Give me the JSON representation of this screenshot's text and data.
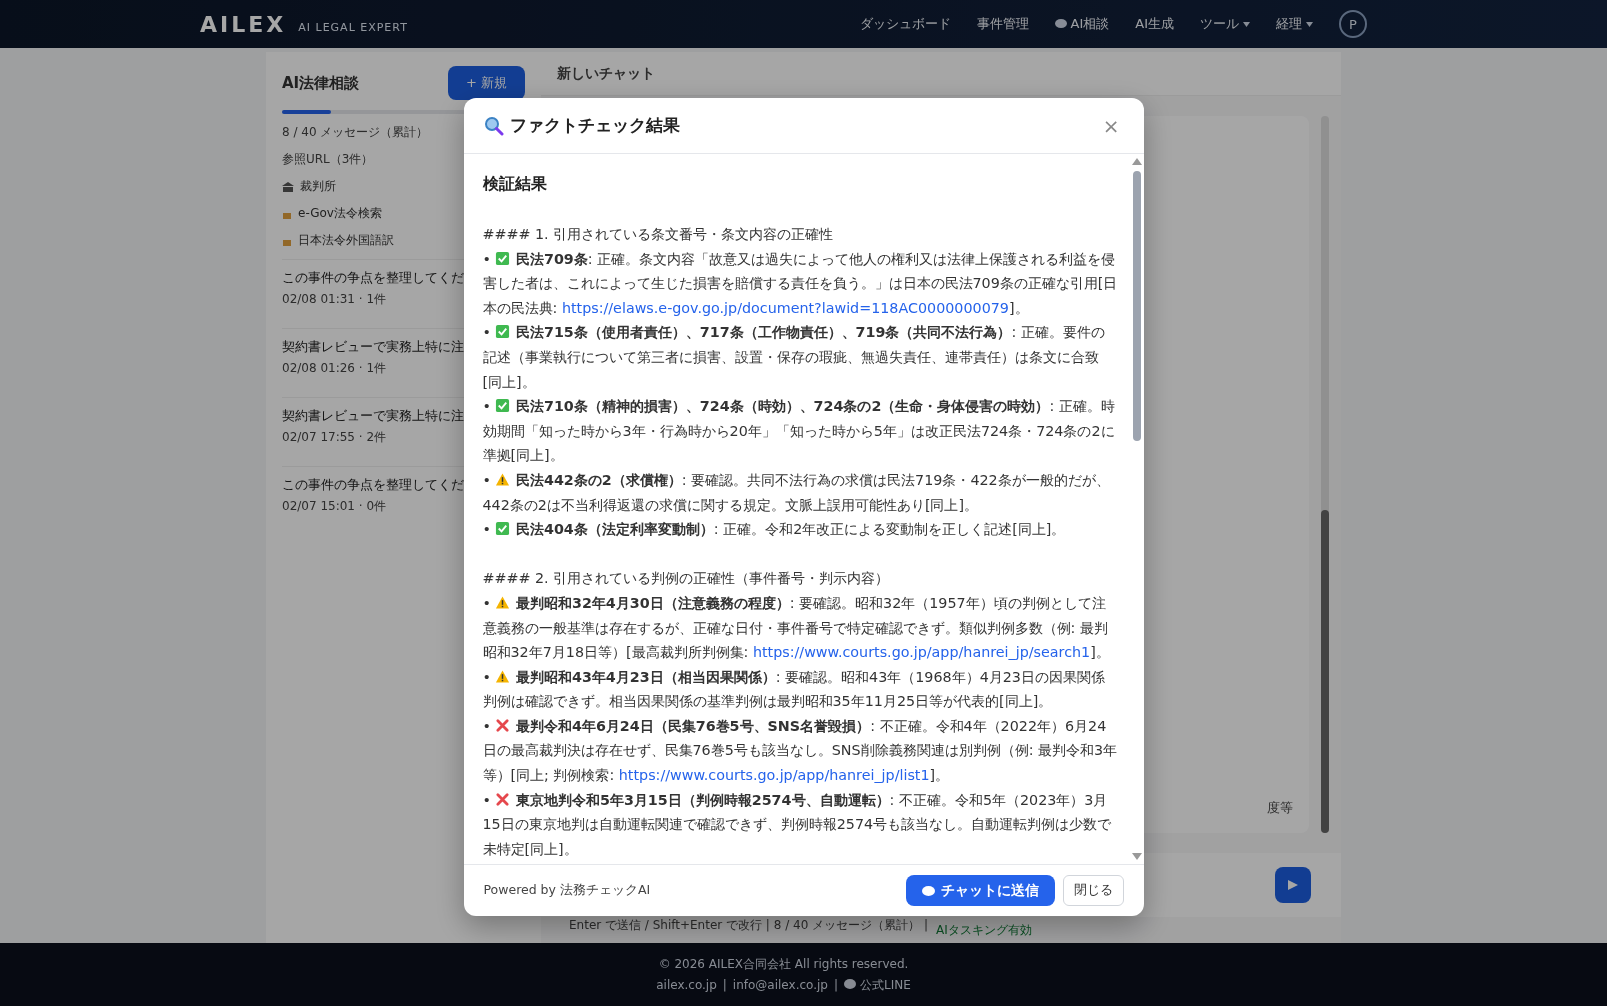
{
  "header": {
    "logo": "AILEX",
    "tagline": "AI LEGAL EXPERT",
    "nav": [
      {
        "label": "ダッシュボード",
        "kind": "plain"
      },
      {
        "label": "事件管理",
        "kind": "plain"
      },
      {
        "label": "AI相談",
        "kind": "chat"
      },
      {
        "label": "AI生成",
        "kind": "plain"
      },
      {
        "label": "ツール",
        "kind": "menu"
      },
      {
        "label": "経理",
        "kind": "menu"
      }
    ],
    "avatar": "P"
  },
  "sidebar": {
    "title": "AI法律相談",
    "new_button": "+ 新規",
    "usage": {
      "level": 0.2,
      "text": "8 / 40 メッセージ（累計）"
    },
    "refs_title": "参照URL（3件）",
    "refs": [
      {
        "label": "裁判所",
        "kind": "court"
      },
      {
        "label": "e-Gov法令検索",
        "kind": "lock"
      },
      {
        "label": "日本法令外国語訳",
        "kind": "lock"
      }
    ],
    "history": [
      {
        "title": "この事件の争点を整理してくだ",
        "meta": "02/08 01:31 · 1件"
      },
      {
        "title": "契約書レビューで実務上特に注",
        "meta": "02/08 01:26 · 1件"
      },
      {
        "title": "契約書レビューで実務上特に注",
        "meta": "02/07 17:55 · 2件"
      },
      {
        "title": "この事件の争点を整理してくだ",
        "meta": "02/07 15:01 · 0件"
      }
    ]
  },
  "chat": {
    "title": "新しいチャット",
    "message_tail": "度等",
    "hint": "Enter で送信 / Shift+Enter で改行 | 8 / 40 メッセージ（累計） |",
    "hint_status": "AIタスキング有効"
  },
  "modal": {
    "title": "ファクトチェック結果",
    "heading": "検証結果",
    "blocks": [
      {
        "kind": "section",
        "text": "#### 1. 引用されている条文番号・条文内容の正確性"
      },
      {
        "kind": "ok",
        "marker": "•",
        "term": "民法709条",
        "text": ": 正確。条文内容「故意又は過失によって他人の権利又は法律上保護される利益を侵害した者は、これによって生じた損害を賠償する責任を負う。」は日本の民法709条の正確な引用[日本の民法典: ",
        "link": "https://elaws.e-gov.go.jp/document?lawid=118AC0000000079",
        "tail": "]。"
      },
      {
        "kind": "ok",
        "marker": "•",
        "term": "民法715条（使用者責任）、717条（工作物責任）、719条（共同不法行為）",
        "text": ": 正確。要件の記述（事業執行について第三者に損害、設置・保存の瑕疵、無過失責任、連帯責任）は条文に合致[同上]。"
      },
      {
        "kind": "ok",
        "marker": "•",
        "term": "民法710条（精神的損害）、724条（時効）、724条の2（生命・身体侵害の時効）",
        "text": ": 正確。時効期間「知った時から3年・行為時から20年」「知った時から5年」は改正民法724条・724条の2に準拠[同上]。"
      },
      {
        "kind": "warn",
        "marker": "•",
        "term": "民法442条の2（求償権）",
        "text": ": 要確認。共同不法行為の求償は民法719条・422条が一般的だが、442条の2は不当利得返還の求償に関する規定。文脈上誤用可能性あり[同上]。"
      },
      {
        "kind": "ok",
        "marker": "•",
        "term": "民法404条（法定利率変動制）",
        "text": ": 正確。令和2年改正による変動制を正しく記述[同上]。"
      },
      {
        "kind": "gap"
      },
      {
        "kind": "section",
        "text": "#### 2. 引用されている判例の正確性（事件番号・判示内容）"
      },
      {
        "kind": "warn",
        "marker": "•",
        "term": "最判昭和32年4月30日（注意義務の程度）",
        "text": ": 要確認。昭和32年（1957年）頃の判例として注意義務の一般基準は存在するが、正確な日付・事件番号で特定確認できず。類似判例多数（例: 最判昭和32年7月18日等）[最高裁判所判例集: ",
        "link": "https://www.courts.go.jp/app/hanrei_jp/search1",
        "tail": "]。"
      },
      {
        "kind": "warn",
        "marker": "•",
        "term": "最判昭和43年4月23日（相当因果関係）",
        "text": ": 要確認。昭和43年（1968年）4月23日の因果関係判例は確認できず。相当因果関係の基準判例は最判昭和35年11月25日等が代表的[同上]。"
      },
      {
        "kind": "ng",
        "marker": "•",
        "term": "最判令和4年6月24日（民集76巻5号、SNS名誉毀損）",
        "text": ": 不正確。令和4年（2022年）6月24日の最高裁判決は存在せず、民集76巻5号も該当なし。SNS削除義務関連は別判例（例: 最判令和3年等）[同上; 判例検索: ",
        "link": "https://www.courts.go.jp/app/hanrei_jp/list1",
        "tail": "]。"
      },
      {
        "kind": "ng",
        "marker": "•",
        "term": "東京地判令和5年3月15日（判例時報2574号、自動運転）",
        "text": ": 不正確。令和5年（2023年）3月15日の東京地判は自動運転関連で確認できず、判例時報2574号も該当なし。自動運転判例は少数で未特定[同上]。"
      }
    ],
    "powered": "Powered by 法務チェックAI",
    "send_button": "チャットに送信",
    "close_button": "閉じる",
    "close_icon": "×"
  },
  "footer": {
    "copyright": "© 2026 AILEX合同会社 All rights reserved.",
    "links": [
      {
        "label": "ailex.co.jp",
        "kind": "text"
      },
      {
        "label": "info@ailex.co.jp",
        "kind": "text"
      },
      {
        "label": "公式LINE",
        "kind": "line"
      }
    ],
    "separator": "|"
  }
}
